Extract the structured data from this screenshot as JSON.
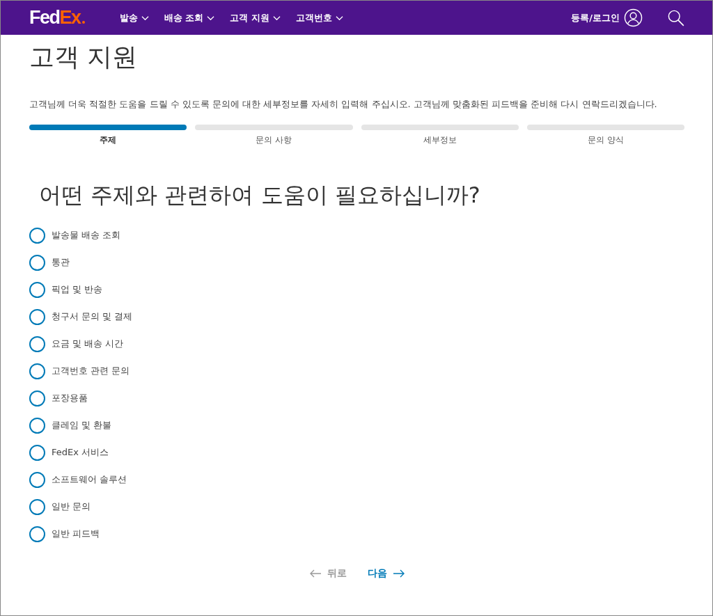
{
  "header": {
    "logo": {
      "first": "Fed",
      "second": "Ex"
    },
    "nav": [
      {
        "label": "발송"
      },
      {
        "label": "배송 조회"
      },
      {
        "label": "고객 지원"
      },
      {
        "label": "고객번호"
      }
    ],
    "login": "등록/로그인"
  },
  "title": "고객 지원",
  "description": "고객님께 더욱 적절한 도움을 드릴 수 있도록 문의에 대한 세부정보를 자세히 입력해 주십시오. 고객님께 맞춤화된 피드백을 준비해 다시 연락드리겠습니다.",
  "steps": [
    {
      "label": "주제",
      "selected": true
    },
    {
      "label": "문의 사항",
      "selected": false
    },
    {
      "label": "세부정보",
      "selected": false
    },
    {
      "label": "문의 양식",
      "selected": false
    }
  ],
  "question": "어떤 주제와 관련하여 도움이 필요하십니까?",
  "options": [
    {
      "label": "발송물 배송 조회",
      "checked": false
    },
    {
      "label": "통관",
      "checked": false
    },
    {
      "label": "픽업 및 반송",
      "checked": false
    },
    {
      "label": "청구서 문의 및 결제",
      "checked": false
    },
    {
      "label": "요금 및 배송 시간",
      "checked": false
    },
    {
      "label": "고객번호 관련 문의",
      "checked": false
    },
    {
      "label": "포장용품",
      "checked": false
    },
    {
      "label": "클레임 및 환불",
      "checked": false
    },
    {
      "label": "FedEx 서비스",
      "checked": false
    },
    {
      "label": "소프트웨어 솔루션",
      "checked": false
    },
    {
      "label": "일반 문의",
      "checked": false
    },
    {
      "label": "일반 피드백",
      "checked": false
    }
  ],
  "back": {
    "label": "뒤로",
    "disabled": true
  },
  "next": {
    "label": "다음",
    "disabled": false
  }
}
